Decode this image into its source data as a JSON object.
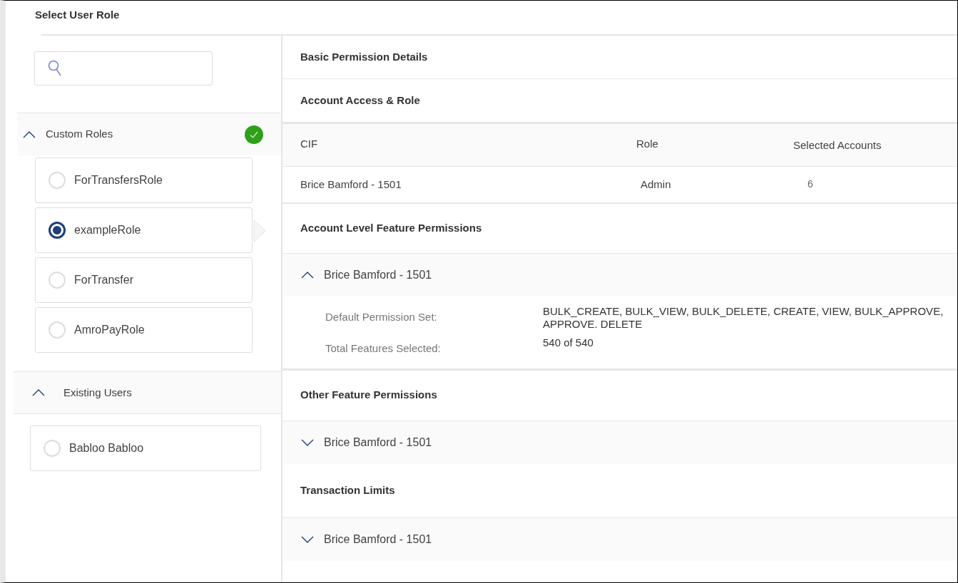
{
  "title": "Select User Role",
  "groups": [
    {
      "title": "Custom Roles",
      "expanded": true,
      "complete": true,
      "items": [
        {
          "label": "ForTransfersRole",
          "selected": false
        },
        {
          "label": "exampleRole",
          "selected": true
        },
        {
          "label": "ForTransfer",
          "selected": false
        },
        {
          "label": "AmroPayRole",
          "selected": false
        }
      ]
    },
    {
      "title": "Existing Users",
      "expanded": true,
      "complete": false,
      "items": [
        {
          "label": "Babloo Babloo",
          "selected": false
        }
      ]
    }
  ],
  "details_title": "Basic Permission Details",
  "sections": [
    {
      "kind": "table",
      "title": "Account Access & Role",
      "columns": [
        "CIF",
        "Role",
        "Selected Accounts"
      ],
      "rows": [
        [
          "Brice Bamford  - 1501",
          "Admin",
          "6"
        ]
      ]
    },
    {
      "kind": "accordion",
      "title": "Account Level Feature Permissions",
      "panels": [
        {
          "title": "Brice Bamford - 1501",
          "expanded": true,
          "fields": [
            {
              "label": "Default Permission Set:",
              "value": "BULK_CREATE, BULK_VIEW, BULK_DELETE, CREATE, VIEW, BULK_APPROVE, APPROVE. DELETE"
            },
            {
              "label": "Total Features Selected:",
              "value": "540 of 540"
            }
          ]
        }
      ]
    },
    {
      "kind": "accordion",
      "title": "Other Feature Permissions",
      "panels": [
        {
          "title": "Brice Bamford - 1501",
          "expanded": false
        }
      ]
    },
    {
      "kind": "accordion",
      "title": "Transaction Limits",
      "panels": [
        {
          "title": "Brice Bamford - 1501",
          "expanded": false
        }
      ]
    }
  ]
}
